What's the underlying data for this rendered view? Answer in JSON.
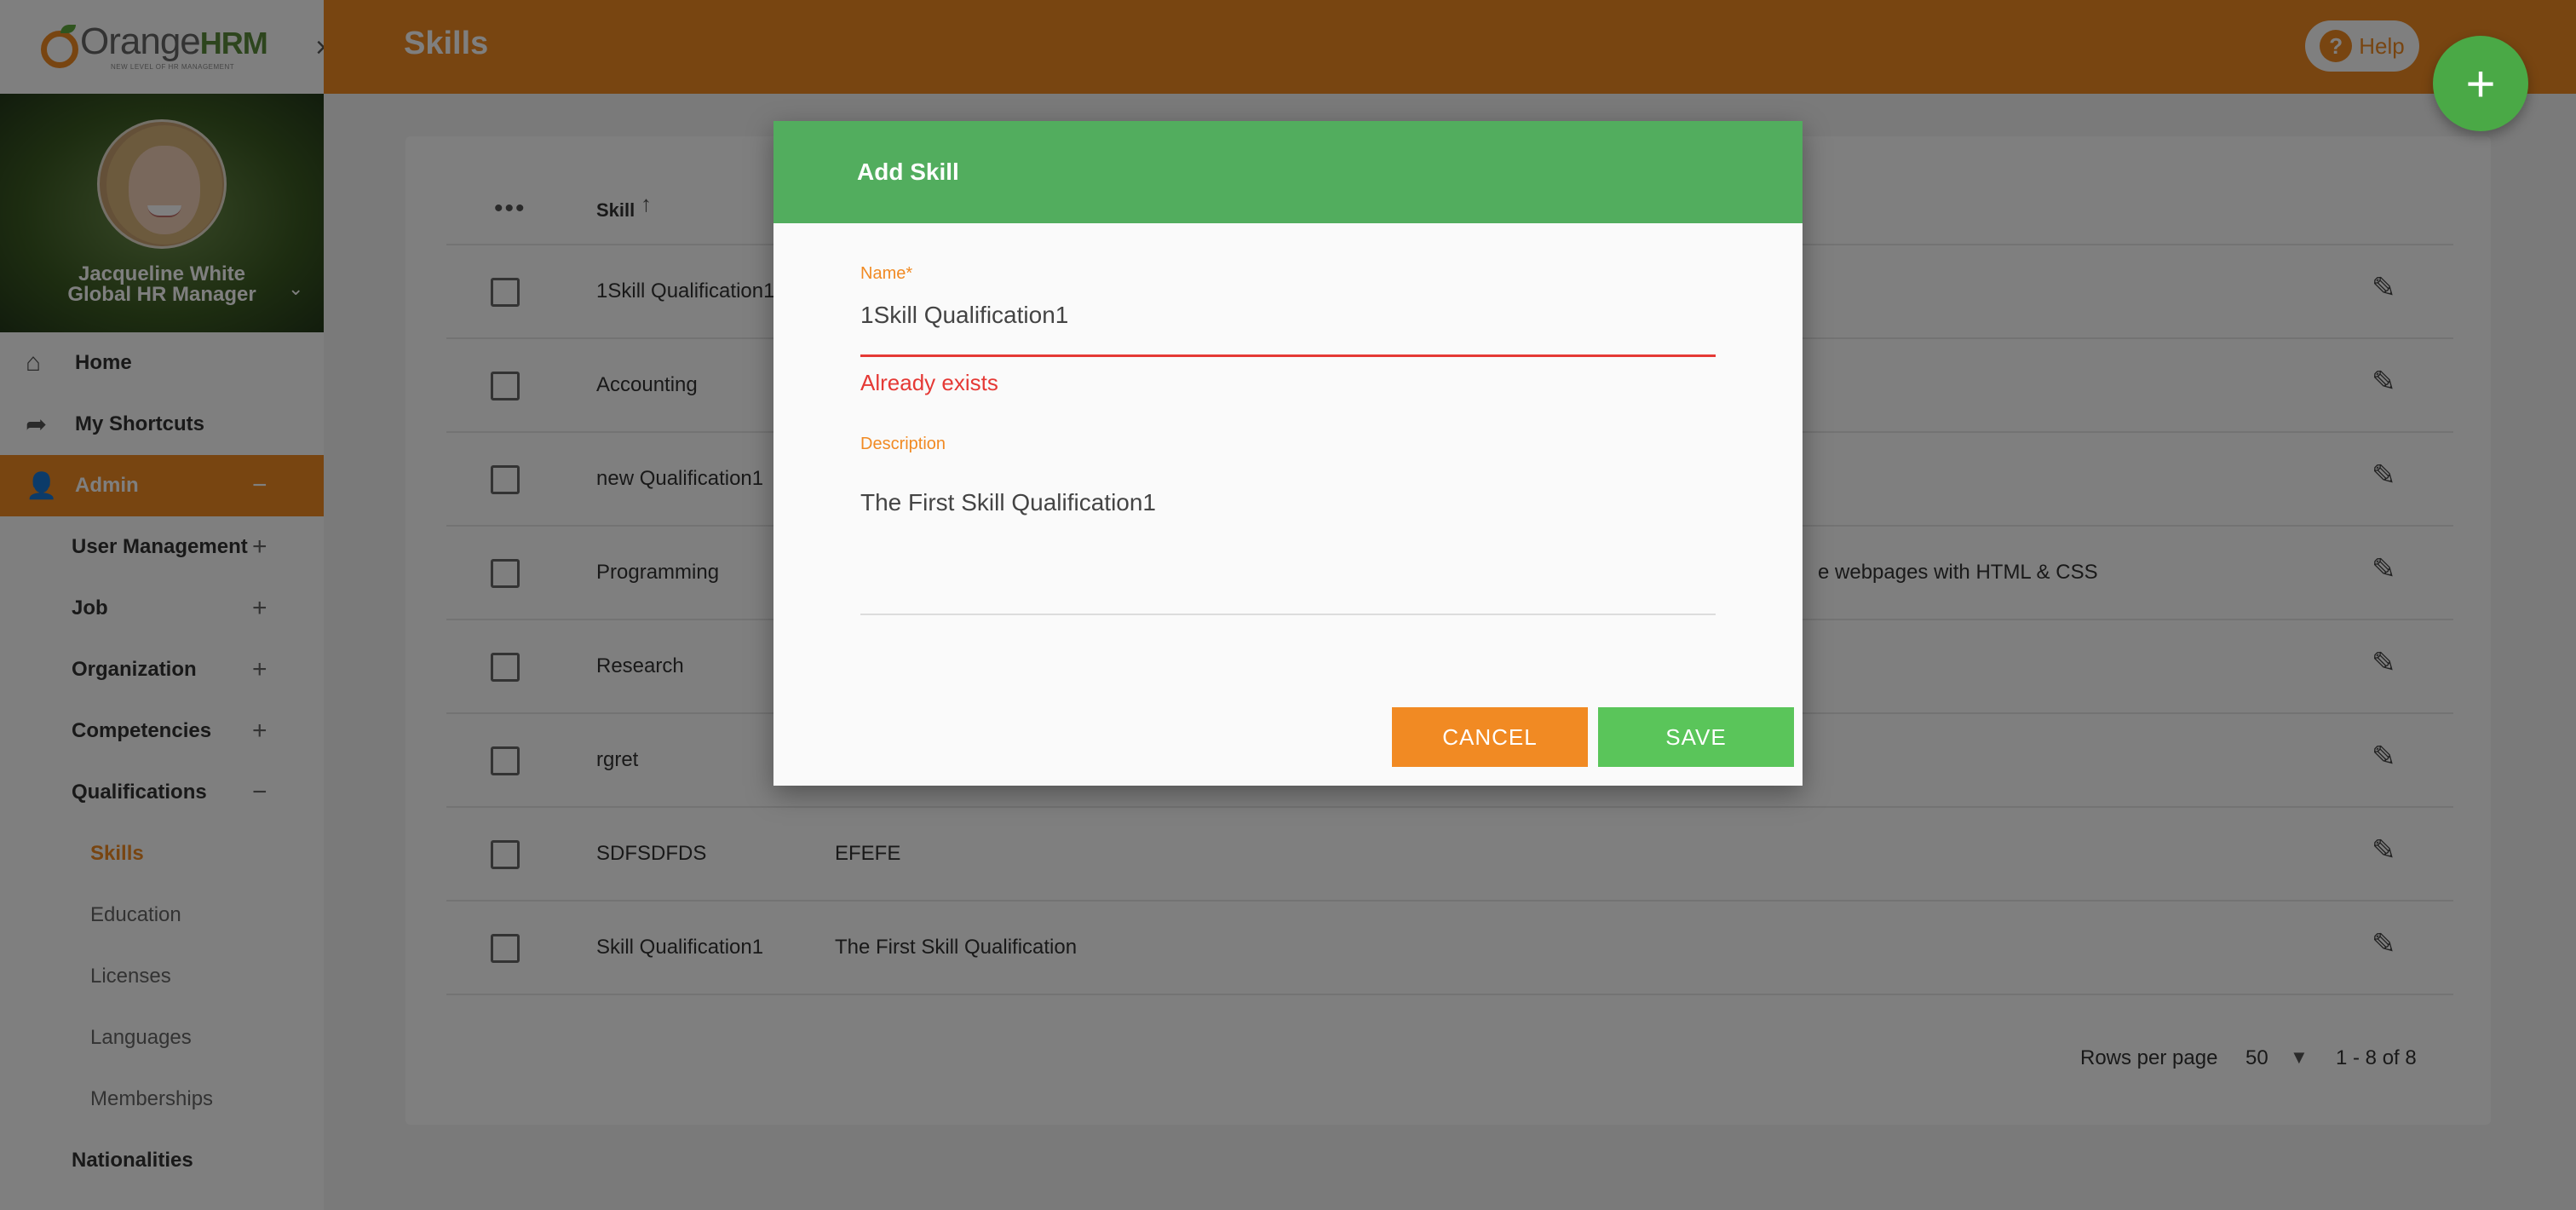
{
  "brand": {
    "logo_text_a": "Orange",
    "logo_text_b": "HRM",
    "tagline": "NEW LEVEL OF HR MANAGEMENT"
  },
  "profile": {
    "name": "Jacqueline White",
    "role": "Global HR Manager"
  },
  "sidebar": {
    "home": "Home",
    "shortcuts": "My Shortcuts",
    "admin": "Admin",
    "admin_items": [
      {
        "label": "User Management",
        "toggle": "+"
      },
      {
        "label": "Job",
        "toggle": "+"
      },
      {
        "label": "Organization",
        "toggle": "+"
      },
      {
        "label": "Competencies",
        "toggle": "+"
      },
      {
        "label": "Qualifications",
        "toggle": "−"
      }
    ],
    "qualifications_items": [
      "Skills",
      "Education",
      "Licenses",
      "Languages",
      "Memberships"
    ],
    "nationalities": "Nationalities",
    "admin_toggle": "−"
  },
  "header": {
    "title": "Skills",
    "help": "Help"
  },
  "table": {
    "col_skill": "Skill",
    "rows": [
      {
        "skill": "1Skill Qualification1",
        "desc": ""
      },
      {
        "skill": "Accounting",
        "desc": ""
      },
      {
        "skill": "new Qualification1",
        "desc": ""
      },
      {
        "skill": "Programming",
        "desc": "e webpages with HTML & CSS"
      },
      {
        "skill": "Research",
        "desc": ""
      },
      {
        "skill": "rgret",
        "desc": ""
      },
      {
        "skill": "SDFSDFDS",
        "desc": "EFEFE"
      },
      {
        "skill": "Skill Qualification1",
        "desc": "The First Skill Qualification"
      }
    ]
  },
  "pagination": {
    "rows_per_page_label": "Rows per page",
    "rows_per_page": "50",
    "range": "1 - 8 of 8"
  },
  "modal": {
    "title": "Add Skill",
    "name_label": "Name",
    "required_mark": "*",
    "name_value": "1Skill Qualification1",
    "error": "Already exists",
    "desc_label": "Description",
    "desc_value": "The First Skill Qualification1",
    "cancel": "CANCEL",
    "save": "SAVE"
  },
  "colors": {
    "brand_orange": "#f18a23",
    "header_green": "#52ad5e",
    "save_green": "#5ac55a",
    "error_red": "#e53935"
  }
}
